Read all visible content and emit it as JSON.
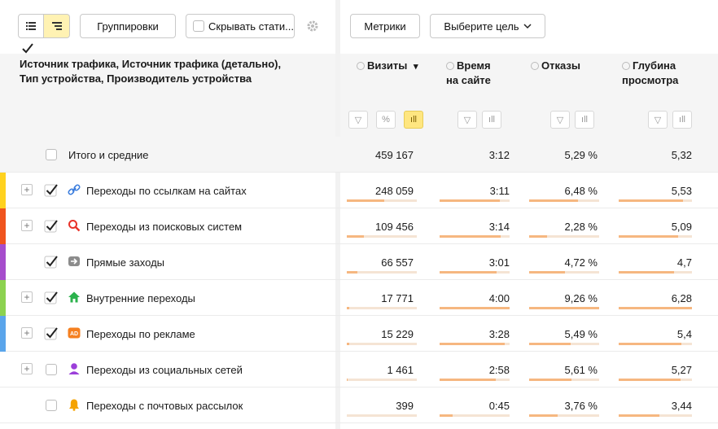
{
  "toolbar": {
    "grouping_label": "Группировки",
    "hide_stats_label": "Скрывать стати...",
    "metrics_label": "Метрики",
    "goal_label": "Выберите цель"
  },
  "header": {
    "dimensions_title": "Источник трафика, Источник трафика (детально), Тип устройства, Производитель устройства",
    "columns": [
      {
        "label": "Визиты",
        "sort": "▾"
      },
      {
        "label_line1": "Время",
        "label_line2": "на сайте"
      },
      {
        "label": "Отказы"
      },
      {
        "label_line1": "Глубина",
        "label_line2": "просмотра"
      }
    ]
  },
  "totals": {
    "label": "Итого и средние",
    "visits": "459 167",
    "time": "3:12",
    "bounce": "5,29 %",
    "depth": "5,32"
  },
  "rows": [
    {
      "label": "Переходы по ссылкам на сайтах",
      "visits": "248 059",
      "time": "3:11",
      "bounce": "6,48 %",
      "depth": "5,53",
      "strip_color": "#ffd21f",
      "icon": "link-icon",
      "expandable": true,
      "checked": true,
      "fill": {
        "visits": 0.54,
        "time": 0.86,
        "bounce": 0.7,
        "depth": 0.88
      }
    },
    {
      "label": "Переходы из поисковых систем",
      "visits": "109 456",
      "time": "3:14",
      "bounce": "2,28 %",
      "depth": "5,09",
      "strip_color": "#f0541e",
      "icon": "search-icon",
      "expandable": true,
      "checked": true,
      "fill": {
        "visits": 0.24,
        "time": 0.87,
        "bounce": 0.25,
        "depth": 0.81
      }
    },
    {
      "label": "Прямые заходы",
      "visits": "66 557",
      "time": "3:01",
      "bounce": "4,72 %",
      "depth": "4,7",
      "strip_color": "#a64dcc",
      "icon": "direct-icon",
      "expandable": false,
      "checked": true,
      "fill": {
        "visits": 0.15,
        "time": 0.81,
        "bounce": 0.51,
        "depth": 0.75
      }
    },
    {
      "label": "Внутренние переходы",
      "visits": "17 771",
      "time": "4:00",
      "bounce": "9,26 %",
      "depth": "6,28",
      "strip_color": "#8cd250",
      "icon": "home-icon",
      "expandable": true,
      "checked": true,
      "fill": {
        "visits": 0.04,
        "time": 1.0,
        "bounce": 1.0,
        "depth": 1.0
      }
    },
    {
      "label": "Переходы по рекламе",
      "visits": "15 229",
      "time": "3:28",
      "bounce": "5,49 %",
      "depth": "5,4",
      "strip_color": "#5aa5eb",
      "icon": "ad-icon",
      "expandable": true,
      "checked": true,
      "fill": {
        "visits": 0.03,
        "time": 0.93,
        "bounce": 0.59,
        "depth": 0.86
      }
    },
    {
      "label": "Переходы из социальных сетей",
      "visits": "1 461",
      "time": "2:58",
      "bounce": "5,61 %",
      "depth": "5,27",
      "strip_color": "",
      "icon": "social-icon",
      "expandable": true,
      "checked": false,
      "fill": {
        "visits": 0.01,
        "time": 0.8,
        "bounce": 0.61,
        "depth": 0.84
      }
    },
    {
      "label": "Переходы с почтовых рассылок",
      "visits": "399",
      "time": "0:45",
      "bounce": "3,76 %",
      "depth": "3,44",
      "strip_color": "",
      "icon": "bell-icon",
      "expandable": false,
      "checked": false,
      "fill": {
        "visits": 0.0,
        "time": 0.19,
        "bounce": 0.41,
        "depth": 0.55
      }
    }
  ]
}
